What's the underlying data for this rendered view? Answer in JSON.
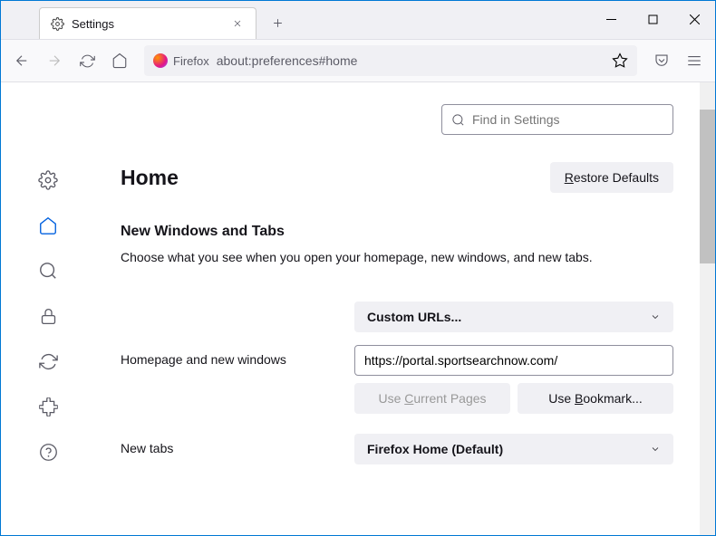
{
  "tab": {
    "title": "Settings"
  },
  "toolbar": {
    "identity": "Firefox",
    "url": "about:preferences#home"
  },
  "search": {
    "placeholder": "Find in Settings"
  },
  "page": {
    "title": "Home",
    "restore_defaults": "Restore Defaults",
    "section_title": "New Windows and Tabs",
    "section_desc": "Choose what you see when you open your homepage, new windows, and new tabs."
  },
  "homepage": {
    "label": "Homepage and new windows",
    "dropdown": "Custom URLs...",
    "url": "https://portal.sportsearchnow.com/",
    "use_current": "Use Current Pages",
    "use_bookmark": "Use Bookmark..."
  },
  "newtabs": {
    "label": "New tabs",
    "dropdown": "Firefox Home (Default)"
  }
}
